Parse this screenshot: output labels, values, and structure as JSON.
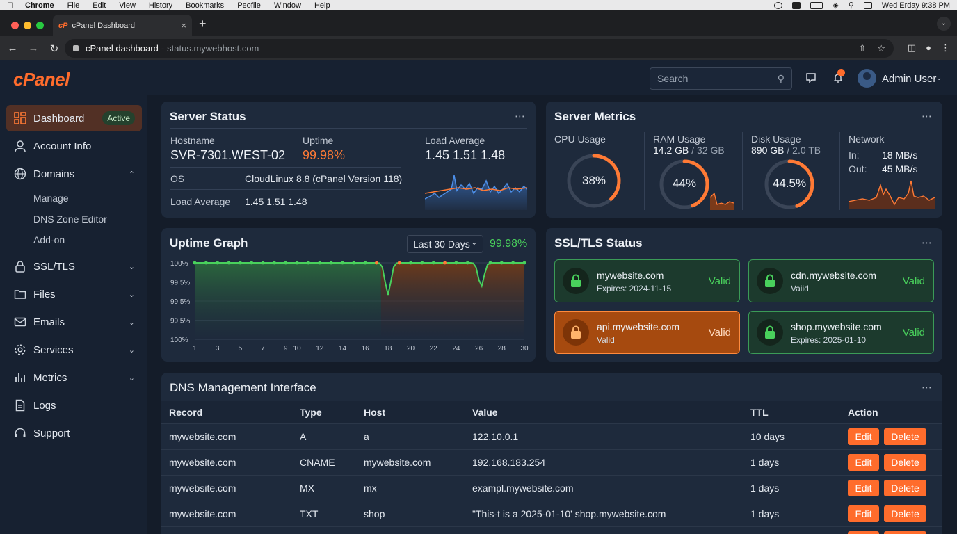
{
  "macos": {
    "menus": [
      "Chrome",
      "File",
      "Edit",
      "View",
      "History",
      "Bookmarks",
      "Peofile",
      "Window",
      "Help"
    ],
    "clock": "Wed Erday  9:38 PM"
  },
  "browser": {
    "tab_title": "cPanel Dashboard",
    "favicon_text": "cP",
    "url_title": "cPanel dashboard",
    "url_sep": "-",
    "url_host": "status.mywebhost.com"
  },
  "sidebar": {
    "logo": "cPanel",
    "items": [
      {
        "label": "Dashboard",
        "icon": "dashboard-icon",
        "badge": "Active"
      },
      {
        "label": "Account Info",
        "icon": "user-icon"
      },
      {
        "label": "Domains",
        "icon": "globe-icon"
      },
      {
        "label": "SSL/TLS",
        "icon": "lock-icon"
      },
      {
        "label": "Files",
        "icon": "folder-icon"
      },
      {
        "label": "Emails",
        "icon": "mail-icon"
      },
      {
        "label": "Services",
        "icon": "gear-icon"
      },
      {
        "label": "Metrics",
        "icon": "bar-chart-icon"
      },
      {
        "label": "Logs",
        "icon": "document-icon"
      },
      {
        "label": "Support",
        "icon": "headset-icon"
      }
    ],
    "domain_sub": [
      "Manage",
      "DNS Zone Editor",
      "Add-on"
    ]
  },
  "header": {
    "search_placeholder": "Search",
    "username": "Admin User"
  },
  "server_status": {
    "title": "Server Status",
    "hostname_label": "Hostname",
    "hostname": "SVR-7301.WEST-02",
    "uptime_label": "Uptime",
    "uptime": "99.98%",
    "load_label": "Load Average",
    "load_values": "1.45  1.51  1.48",
    "os_label": "OS",
    "os_value": "CloudLinux 8.8 (cPanel Version 118)",
    "load_row_label": "Load Average",
    "load_row_value": "1.45 1.51 1.48"
  },
  "server_metrics": {
    "title": "Server Metrics",
    "cpu_label": "CPU Usage",
    "cpu_pct": "38%",
    "cpu_value": 38,
    "ram_label": "RAM Usage",
    "ram_used": "14.2 GB",
    "ram_total": "/ 32 GB",
    "ram_pct": "44%",
    "ram_value": 44,
    "disk_label": "Disk Usage",
    "disk_used": "890 GB",
    "disk_total": "/ 2.0 TB",
    "disk_pct": "44.5%",
    "disk_value": 44.5,
    "net_label": "Network",
    "net_in_label": "In:",
    "net_in": "18 MB/s",
    "net_out_label": "Out:",
    "net_out": "45 MB/s"
  },
  "uptime_graph": {
    "title": "Uptime Graph",
    "range": "Last 30 Days",
    "pct": "99.98%",
    "y_ticks": [
      "100%",
      "99.5%",
      "99.5%",
      "99.5%",
      "100%"
    ],
    "x_ticks": [
      "1",
      "3",
      "5",
      "7",
      "9",
      "10",
      "12",
      "14",
      "16",
      "18",
      "20",
      "22",
      "24",
      "26",
      "28",
      "30"
    ]
  },
  "ssl": {
    "title": "SSL/TLS Status",
    "certs": [
      {
        "domain": "mywebsite.com",
        "expiry": "Expires: 2024-11-15",
        "status": "Valid"
      },
      {
        "domain": "cdn.mywebsite.com",
        "expiry": "Vaiid",
        "status": "Valid"
      },
      {
        "domain": "api.mywebsite.com",
        "expiry": "Valid",
        "status": "Valid"
      },
      {
        "domain": "shop.mywebsite.com",
        "expiry": "Expires: 2025-01-10",
        "status": "Valid"
      }
    ]
  },
  "dns": {
    "title": "DNS Management Interface",
    "headers": [
      "Record",
      "Type",
      "Host",
      "Value",
      "TTL",
      "Action"
    ],
    "edit_label": "Edit",
    "delete_label": "Delete",
    "rows": [
      {
        "record": "mywebsite.com",
        "type": "A",
        "host": "a",
        "value": "122.10.0.1",
        "ttl": "10 days"
      },
      {
        "record": "mywebsite.com",
        "type": "CNAME",
        "host": "mywebsite.com",
        "value": "192.168.183.254",
        "ttl": "1 days"
      },
      {
        "record": "mywebsite.com",
        "type": "MX",
        "host": "mx",
        "value": "exampl.mywebsite.com",
        "ttl": "1 days"
      },
      {
        "record": "mywebsite.com",
        "type": "TXT",
        "host": "shop",
        "value": "\"This-t is a 2025-01-10' shop.mywebsite.com",
        "ttl": "1 days"
      }
    ]
  },
  "colors": {
    "accent": "#ff6c2c",
    "success": "#49d15c",
    "card": "#1e2a3c",
    "bg": "#141c29"
  }
}
